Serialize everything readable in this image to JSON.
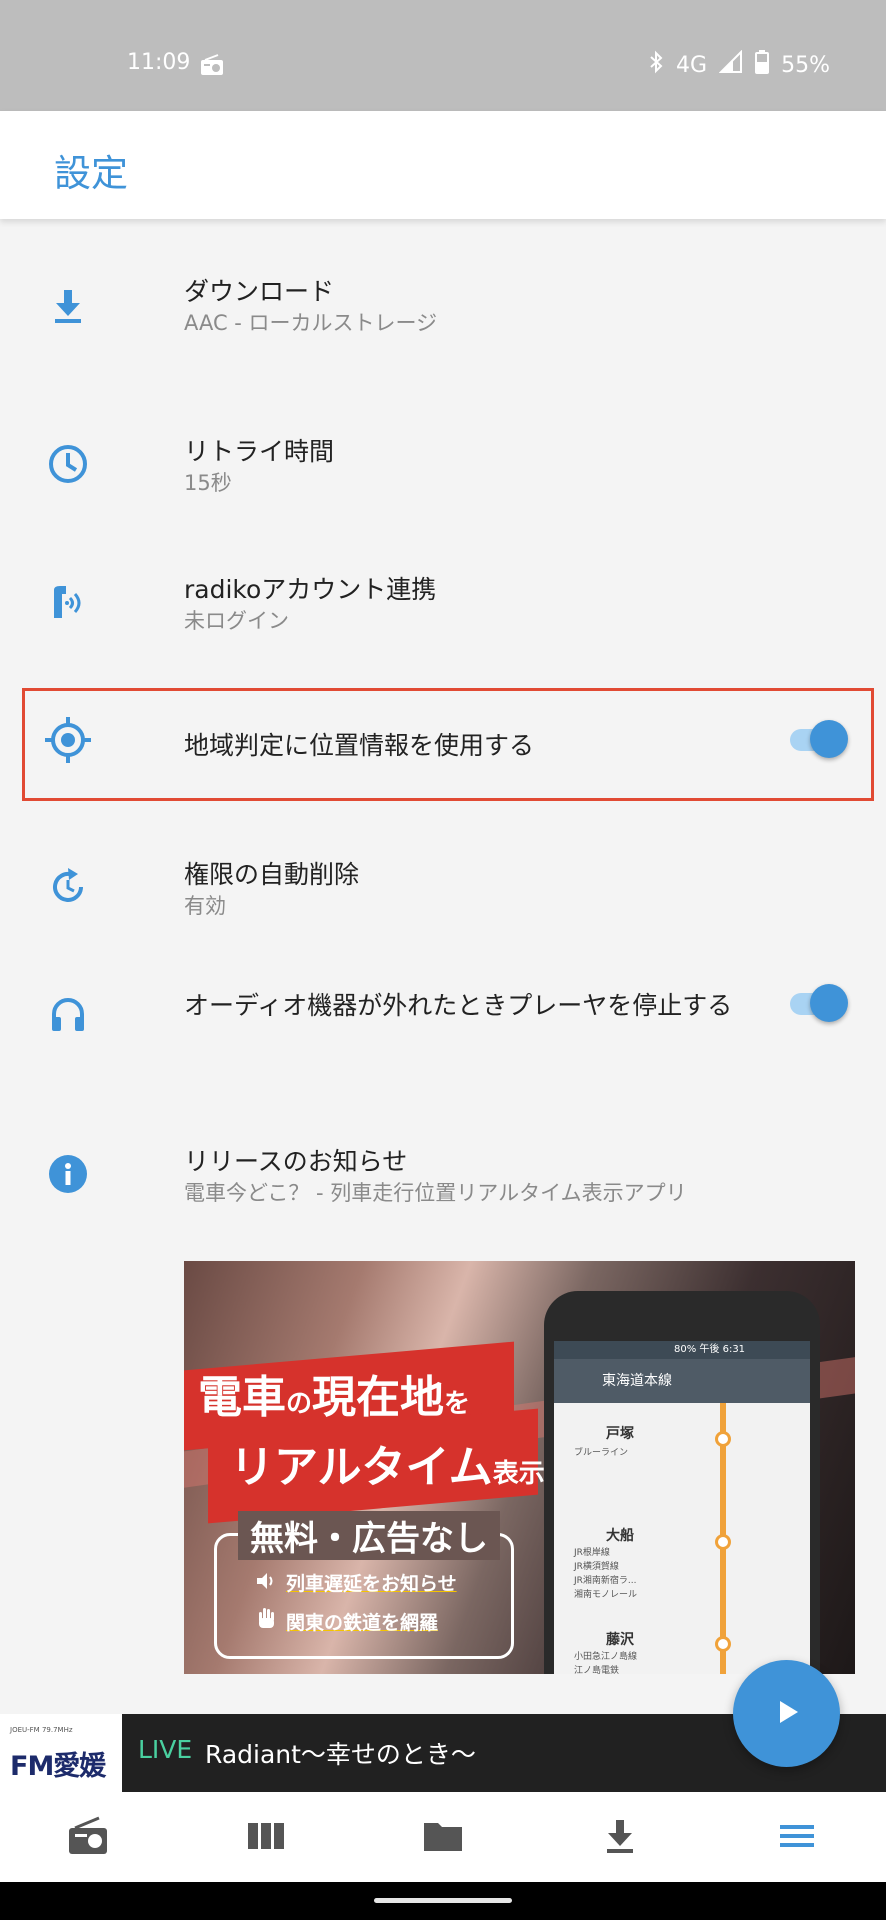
{
  "status_bar": {
    "time": "11:09",
    "network": "4G",
    "battery": "55%"
  },
  "app_bar": {
    "title": "設定"
  },
  "settings": {
    "download": {
      "title": "ダウンロード",
      "subtitle": "AAC - ローカルストレージ",
      "icon": "download-icon"
    },
    "retry": {
      "title": "リトライ時間",
      "subtitle": "15秒",
      "icon": "clock-icon"
    },
    "radiko": {
      "title": "radikoアカウント連携",
      "subtitle": "未ログイン",
      "icon": "radiko-icon"
    },
    "location": {
      "title": "地域判定に位置情報を使用する",
      "enabled": true,
      "icon": "location-target-icon"
    },
    "permissions": {
      "title": "権限の自動削除",
      "subtitle": "有効",
      "icon": "auto-reset-icon"
    },
    "audio_stop": {
      "title": "オーディオ機器が外れたときプレーヤを停止する",
      "enabled": true,
      "icon": "headphones-icon"
    },
    "release": {
      "title": "リリースのお知らせ",
      "subtitle": "電車今どこ？ - 列車走行位置リアルタイム表示アプリ",
      "icon": "info-icon"
    }
  },
  "banner": {
    "headline_1a": "電車",
    "headline_1b": "の",
    "headline_1c": "現在地",
    "headline_1d": "を",
    "headline_2a": "リアルタイム",
    "headline_2b": "表示",
    "free_label": "無料・広告なし",
    "feature_1": "列車遅延をお知らせ",
    "feature_2": "関東の鉄道を網羅",
    "phone": {
      "status": "80% 午後 6:31",
      "line_name": "東海道本線",
      "stations": [
        {
          "name": "戸塚",
          "lines": [
            "ブルーライン"
          ]
        },
        {
          "name": "大船",
          "lines": [
            "JR根岸線",
            "JR横須賀線",
            "JR湘南新宿ラ...",
            "湘南モノレール"
          ]
        },
        {
          "name": "藤沢",
          "lines": [
            "小田急江ノ島線",
            "江ノ島電鉄"
          ]
        }
      ]
    }
  },
  "player": {
    "station_logo_small": "JOEU-FM 79.7MHz",
    "station_logo": "FM愛媛",
    "live_label": "LIVE",
    "track_title": "Radiant〜幸せのとき〜"
  },
  "bottom_nav": [
    "radio-icon",
    "library-icon",
    "folder-icon",
    "download-icon",
    "menu-icon"
  ],
  "colors": {
    "accent": "#3f93d8",
    "highlight": "#e14a33",
    "live": "#4ad0a0"
  }
}
